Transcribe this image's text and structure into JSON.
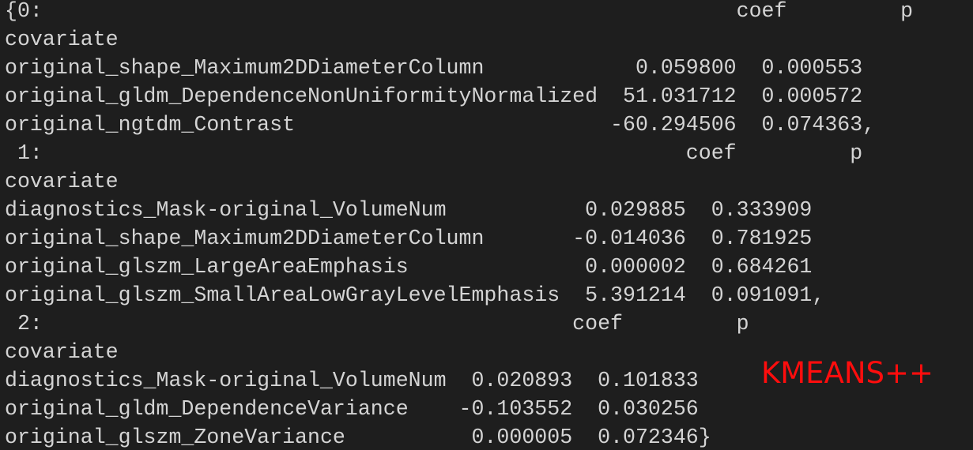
{
  "console": {
    "lines": [
      "{0:                                                       coef         p",
      "covariate",
      "original_shape_Maximum2DDiameterColumn            0.059800  0.000553",
      "original_gldm_DependenceNonUniformityNormalized  51.031712  0.000572",
      "original_ngtdm_Contrast                         -60.294506  0.074363,",
      " 1:                                                   coef         p",
      "covariate",
      "diagnostics_Mask-original_VolumeNum           0.029885  0.333909",
      "original_shape_Maximum2DDiameterColumn       -0.014036  0.781925",
      "original_glszm_LargeAreaEmphasis              0.000002  0.684261",
      "original_glszm_SmallAreaLowGrayLevelEmphasis  5.391214  0.091091,",
      " 2:                                          coef         p",
      "covariate",
      "diagnostics_Mask-original_VolumeNum  0.020893  0.101833",
      "original_gldm_DependenceVariance    -0.103552  0.030256",
      "original_glszm_ZoneVariance          0.000005  0.072346}"
    ]
  },
  "annotation": {
    "text": "KMEANS++",
    "color": "#ff0d0d"
  },
  "theme": {
    "background": "#1e1e1e",
    "foreground": "#d4d4d4"
  }
}
